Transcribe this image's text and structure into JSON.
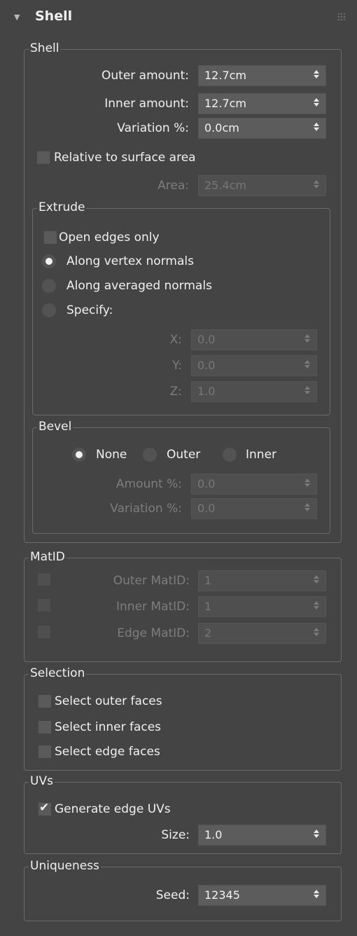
{
  "rollout": {
    "title": "Shell"
  },
  "shell": {
    "legend": "Shell",
    "outer_label": "Outer amount:",
    "outer_value": "12.7cm",
    "inner_label": "Inner amount:",
    "inner_value": "12.7cm",
    "variation_label": "Variation %:",
    "variation_value": "0.0cm",
    "relative_label": "Relative to surface area",
    "relative_checked": false,
    "area_label": "Area:",
    "area_value": "25.4cm"
  },
  "extrude": {
    "legend": "Extrude",
    "open_edges_label": "Open edges only",
    "options": [
      "Along vertex normals",
      "Along averaged normals",
      "Specify:"
    ],
    "selected": "Along vertex normals",
    "x_label": "X:",
    "x_value": "0.0",
    "y_label": "Y:",
    "y_value": "0.0",
    "z_label": "Z:",
    "z_value": "1.0"
  },
  "bevel": {
    "legend": "Bevel",
    "options": [
      "None",
      "Outer",
      "Inner"
    ],
    "selected": "None",
    "amount_label": "Amount %:",
    "amount_value": "0.0",
    "variation_label": "Variation %:",
    "variation_value": "0.0"
  },
  "matid": {
    "legend": "MatID",
    "outer_label": "Outer MatID:",
    "outer_value": "1",
    "inner_label": "Inner MatID:",
    "inner_value": "1",
    "edge_label": "Edge MatID:",
    "edge_value": "2"
  },
  "selection": {
    "legend": "Selection",
    "outer_faces": "Select outer faces",
    "inner_faces": "Select inner faces",
    "edge_faces": "Select edge faces"
  },
  "uvs": {
    "legend": "UVs",
    "generate_label": "Generate edge UVs",
    "generate_checked": true,
    "check_glyph": "✔",
    "size_label": "Size:",
    "size_value": "1.0"
  },
  "uniqueness": {
    "legend": "Uniqueness",
    "seed_label": "Seed:",
    "seed_value": "12345"
  },
  "colors": {
    "background": "#444444",
    "field": "#5c5c5c",
    "text": "#f0f0f0",
    "disabled_text": "#7d7d7d"
  }
}
